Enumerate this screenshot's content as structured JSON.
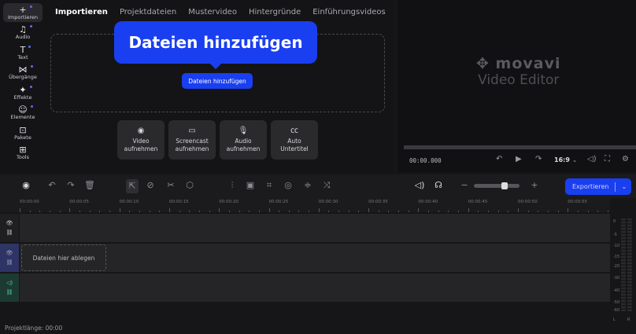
{
  "sidebar": {
    "items": [
      {
        "label": "Importieren",
        "icon": "plus-icon",
        "glyph": "+",
        "active": true
      },
      {
        "label": "Audio",
        "icon": "music-icon",
        "glyph": "♫"
      },
      {
        "label": "Text",
        "icon": "text-icon",
        "glyph": "T"
      },
      {
        "label": "Übergänge",
        "icon": "transition-icon",
        "glyph": "⋈"
      },
      {
        "label": "Effekte",
        "icon": "sparkle-icon",
        "glyph": "✦"
      },
      {
        "label": "Elemente",
        "icon": "smiley-icon",
        "glyph": "☺"
      },
      {
        "label": "Pakete",
        "icon": "bag-icon",
        "glyph": "⊡"
      },
      {
        "label": "Tools",
        "icon": "grid-icon",
        "glyph": "⊞"
      }
    ]
  },
  "tabs": [
    "Importieren",
    "Projektdateien",
    "Mustervideo",
    "Hintergründe",
    "Einführungsvideos"
  ],
  "tooltip": "Dateien hinzufügen",
  "add_button": "Dateien hinzufügen",
  "record_buttons": [
    {
      "line1": "Video",
      "line2": "aufnehmen",
      "glyph": "◉",
      "icon": "webcam-icon"
    },
    {
      "line1": "Screencast",
      "line2": "aufnehmen",
      "glyph": "▭",
      "icon": "screen-icon"
    },
    {
      "line1": "Audio",
      "line2": "aufnehmen",
      "glyph": "🎙",
      "icon": "microphone-icon"
    },
    {
      "line1": "Auto",
      "line2": "Untertitel",
      "glyph": "㏄",
      "icon": "captions-icon"
    }
  ],
  "preview": {
    "logo_brand": "movavi",
    "logo_sub": "Video Editor",
    "timecode": "00:00.000",
    "aspect": "16:9"
  },
  "timeline": {
    "export_label": "Exportieren",
    "ruler": [
      "00:00:00",
      "00:00:05",
      "00:00:10",
      "00:00:15",
      "00:00:20",
      "00:00:25",
      "00:00:30",
      "00:00:35",
      "00:00:40",
      "00:00:45",
      "00:00:50",
      "00:00:55"
    ],
    "dropzone": "Dateien hier ablegen",
    "meter": [
      "0",
      "-5",
      "-10",
      "-15",
      "-20",
      "-30",
      "-40",
      "-50",
      "-60",
      "L",
      "R"
    ],
    "project_length": "Projektlänge: 00:00"
  },
  "colors": {
    "accent": "#1a3ff0"
  }
}
